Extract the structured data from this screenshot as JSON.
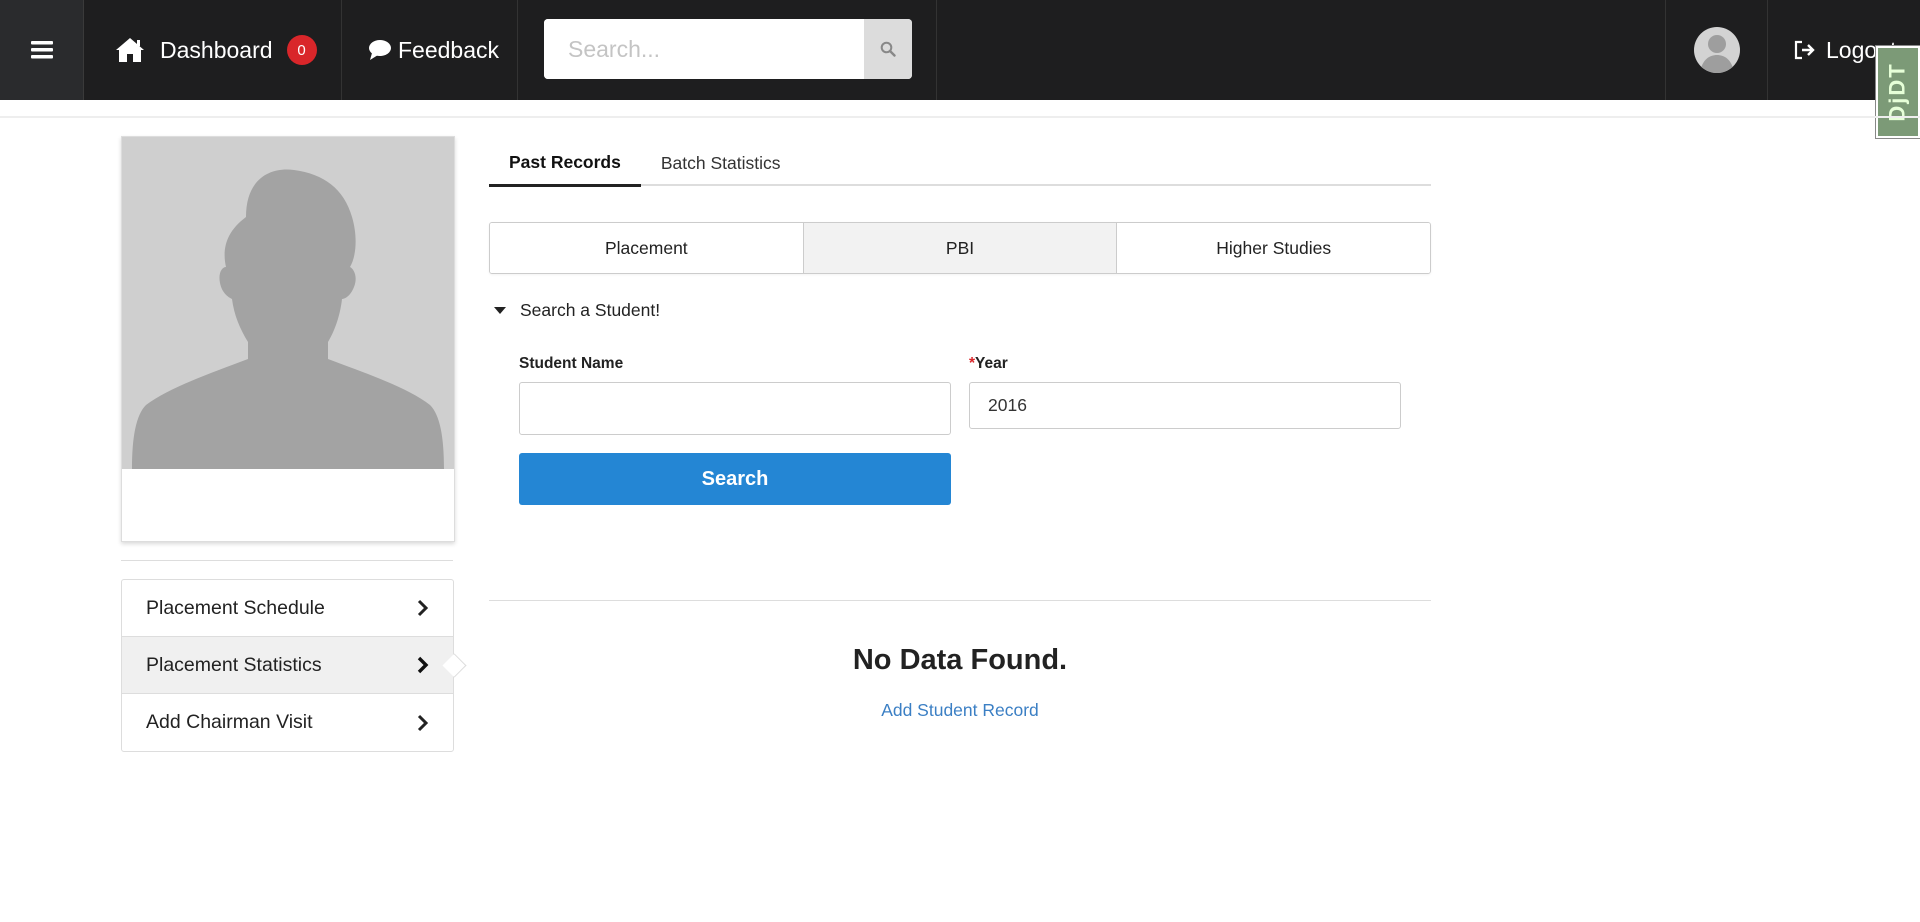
{
  "navbar": {
    "dashboard_label": "Dashboard",
    "notification_count": "0",
    "feedback_label": "Feedback",
    "search_placeholder": "Search...",
    "logout_label": "Logout",
    "debug_toolbar_label": "DjDT"
  },
  "tabs": [
    {
      "label": "Past Records",
      "active": true
    },
    {
      "label": "Batch Statistics",
      "active": false
    }
  ],
  "segments": [
    {
      "label": "Placement",
      "active": false
    },
    {
      "label": "PBI",
      "active": true
    },
    {
      "label": "Higher Studies",
      "active": false
    }
  ],
  "search_form": {
    "heading": "Search a Student!",
    "student_name_label": "Student Name",
    "student_name_value": "",
    "year_required_marker": "*",
    "year_label": "Year",
    "year_value": "2016",
    "submit_label": "Search"
  },
  "sidebar": {
    "items": [
      {
        "label": "Placement Schedule",
        "active": false
      },
      {
        "label": "Placement Statistics",
        "active": true
      },
      {
        "label": "Add Chairman Visit",
        "active": false
      }
    ]
  },
  "results": {
    "empty_message": "No Data Found.",
    "add_link": "Add Student Record"
  }
}
